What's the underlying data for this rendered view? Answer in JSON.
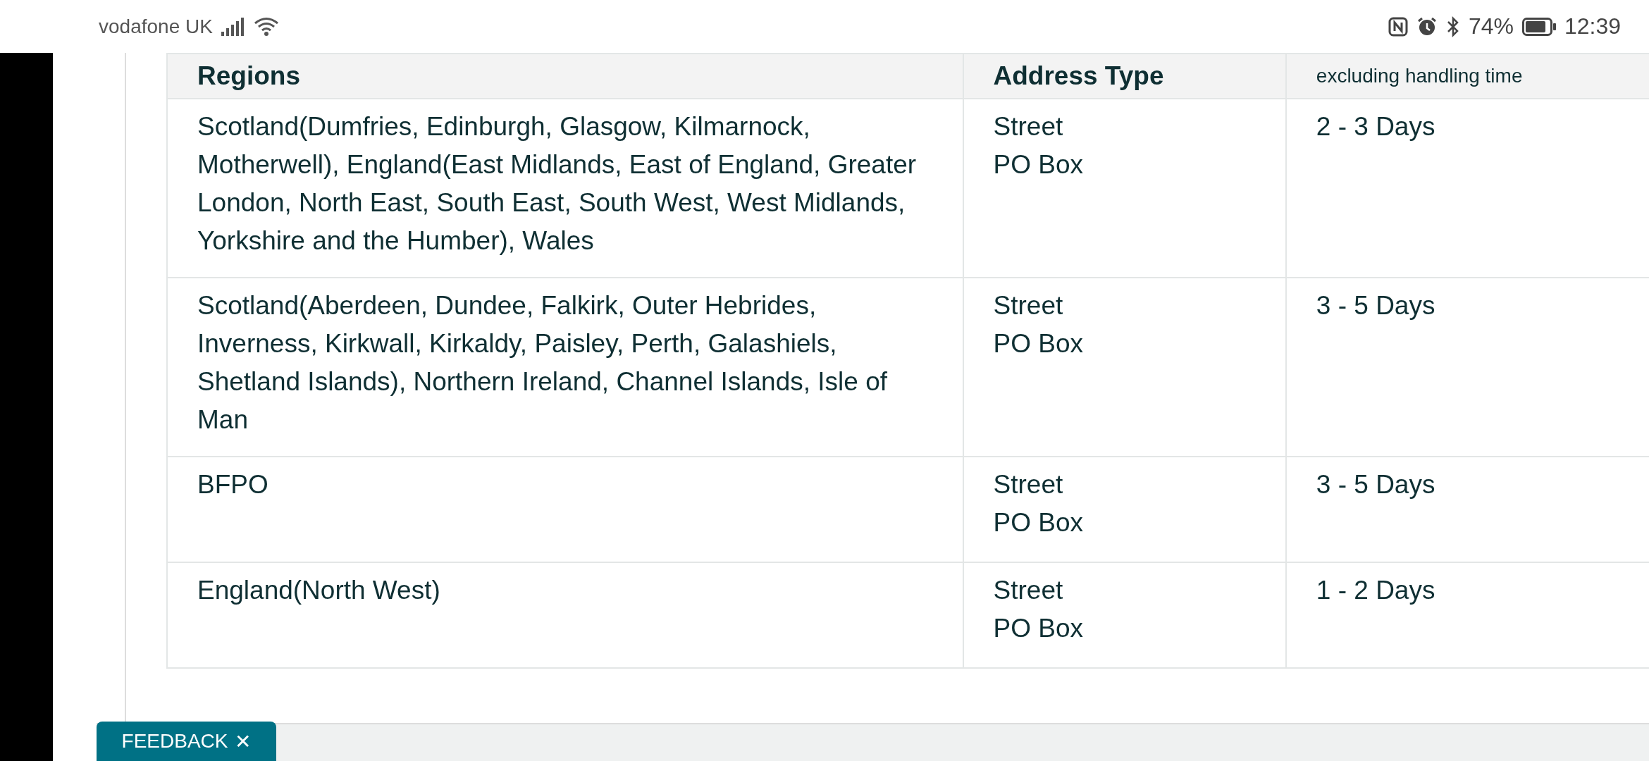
{
  "status_bar": {
    "carrier": "vodafone UK",
    "battery": "74%",
    "time": "12:39"
  },
  "table": {
    "columns": [
      "Regions",
      "Address Type",
      "excluding handling time"
    ],
    "rows": [
      {
        "regions": "Scotland(Dumfries, Edinburgh, Glasgow, Kilmarnock, Motherwell), England(East Midlands, East of England, Greater London, North East, South East, South West, West Midlands, Yorkshire and the Humber), Wales",
        "address_types": [
          "Street",
          "PO Box"
        ],
        "time": "2 - 3 Days"
      },
      {
        "regions": "Scotland(Aberdeen, Dundee, Falkirk, Outer Hebrides, Inverness, Kirkwall, Kirkaldy, Paisley, Perth, Galashiels, Shetland Islands), Northern Ireland, Channel Islands, Isle of Man",
        "address_types": [
          "Street",
          "PO Box"
        ],
        "time": "3 - 5 Days"
      },
      {
        "regions": "BFPO",
        "address_types": [
          "Street",
          "PO Box"
        ],
        "time": "3 - 5 Days"
      },
      {
        "regions": "England(North West)",
        "address_types": [
          "Street",
          "PO Box"
        ],
        "time": "1 - 2 Days"
      }
    ]
  },
  "feedback_tab": {
    "label": "FEEDBACK",
    "close": "✕"
  }
}
